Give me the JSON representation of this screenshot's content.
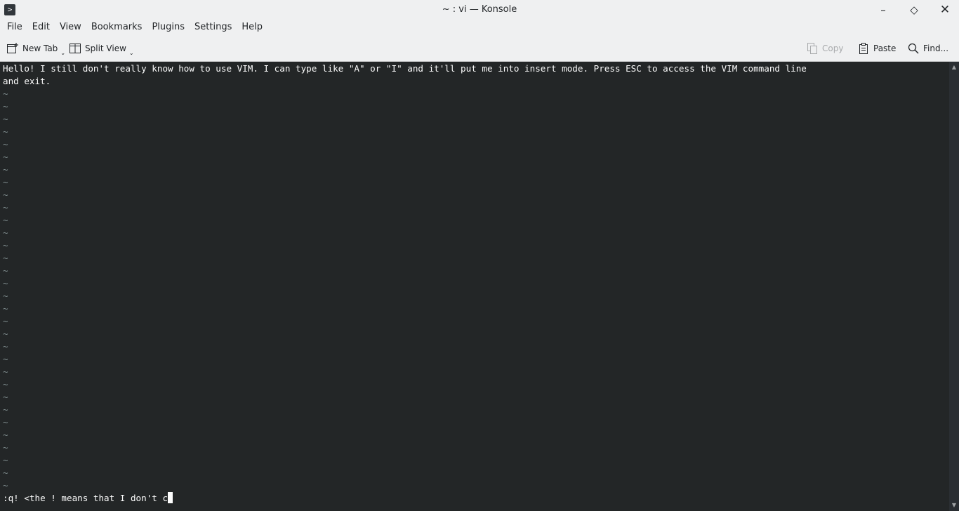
{
  "window": {
    "title": "~ : vi — Konsole"
  },
  "menu": [
    "File",
    "Edit",
    "View",
    "Bookmarks",
    "Plugins",
    "Settings",
    "Help"
  ],
  "toolbar": {
    "new_tab_label": "New Tab",
    "split_view_label": "Split View",
    "copy_label": "Copy",
    "paste_label": "Paste",
    "find_label": "Find..."
  },
  "terminal": {
    "lines": [
      "Hello! I still don't really know how to use VIM. I can type like \"A\" or \"I\" and it'll put me into insert mode. Press ESC to access the VIM command line",
      "and exit."
    ],
    "empty_marker": "~",
    "command_line": ":q! <the ! means that I don't c"
  },
  "colors": {
    "terminal_bg": "#232627",
    "terminal_fg": "#fcfcfc",
    "chrome_bg": "#eff0f1"
  }
}
